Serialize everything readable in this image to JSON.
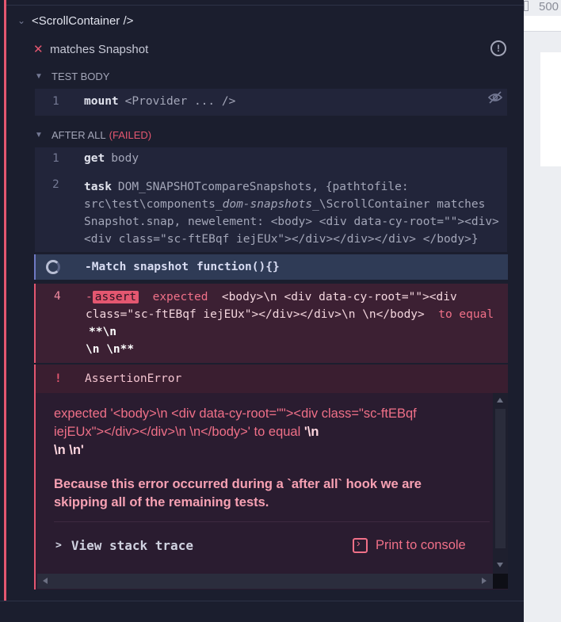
{
  "viewport": {
    "width_label": "500"
  },
  "suite": {
    "title": "<ScrollContainer />"
  },
  "test": {
    "title": "matches Snapshot"
  },
  "test_body": {
    "heading": "TEST BODY",
    "commands": [
      {
        "num": "1",
        "name": "mount",
        "message": "<Provider ... />"
      }
    ]
  },
  "after_all": {
    "heading": "AFTER ALL",
    "status": "(FAILED)",
    "commands": [
      {
        "num": "1",
        "name": "get",
        "message": "body"
      },
      {
        "num": "2",
        "name": "task",
        "message_line1": "DOM_SNAPSHOTcompareSnapshots, {pathtofile:",
        "message_line2_pre": "src\\test\\components_",
        "message_line2_em": "dom-snapshots",
        "message_line2_post": "_\\ScrollContainer matches",
        "message_line3": "Snapshot.snap, newelement: <body> <div data-cy-root=\"\"><div>",
        "message_line4": "<div class=\"sc-ftEBqf iejEUx\"></div></div></div> </body>}"
      }
    ],
    "match": {
      "label": "-Match snapshot",
      "fn": "function(){}"
    },
    "assert": {
      "num": "4",
      "dash": "-",
      "tag": "assert",
      "expected_word": "expected",
      "value_line1": "<body>\\n <div data-cy-root=\"\"><div",
      "value_line2": "class=\"sc-ftEBqf iejEUx\"></div></div>\\n \\n</body>",
      "to_equal": "to equal",
      "bold_line2": "**\\n",
      "bold_line3": "\\n \\n**"
    }
  },
  "error": {
    "bang": "!",
    "name": "AssertionError",
    "message_line1": "expected '<body>\\n    <div data-cy-root=\"\"><div class=\"sc-ftEBqf",
    "message_line2_pre": "iejEUx\"></div></div>\\n  \\n</body>' to equal ",
    "message_line2_bold": "'\\n",
    "message_line3_bold": "\\n \\n'",
    "note": "Because this error occurred during a `after all` hook we are skipping all of the remaining tests.",
    "stack_label": "View stack trace",
    "print_label": "Print to console"
  },
  "colors": {
    "fail": "#e45770",
    "background": "#1b1e2e",
    "panel": "#22253a"
  }
}
